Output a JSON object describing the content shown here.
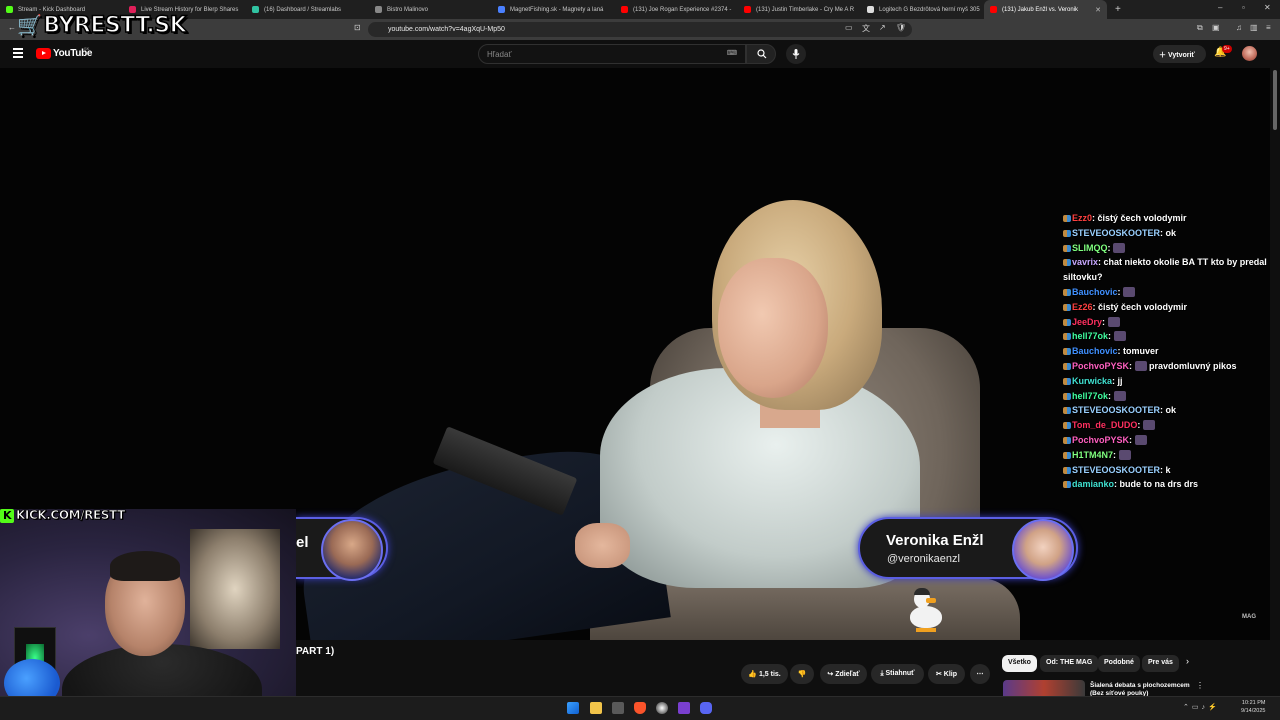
{
  "browser": {
    "tabs": [
      {
        "title": "Stream - Kick Dashboard",
        "color": "#53fc18"
      },
      {
        "title": "Live Stream History for Blerp Shares",
        "color": "#e0205a"
      },
      {
        "title": "(16) Dashboard / Streamlabs",
        "color": "#31c3a2"
      },
      {
        "title": "Bistro Malinovo",
        "color": "#888888"
      },
      {
        "title": "MagnetFishing.sk - Magnety a laná",
        "color": "#4a80ff"
      },
      {
        "title": "(131) Joe Rogan Experience #2374 -",
        "color": "#ff0000"
      },
      {
        "title": "(131) Justin Timberlake - Cry Me A R",
        "color": "#ff0000"
      },
      {
        "title": "Logitech G Bezdrôtová herní myš 305",
        "color": "#dddddd"
      },
      {
        "title": "(131) Jakub Enžl vs. Veronik",
        "color": "#ff0000",
        "active": true
      }
    ],
    "new_tab": "+",
    "url": "youtube.com/watch?v=4agXqU-Mp50"
  },
  "overlay": {
    "logo_text": "BYRESTT.SK",
    "kick_url": "KICK.COM/RESTT",
    "kick_k": "K"
  },
  "youtube": {
    "logo_text": "YouTube",
    "country": "SK",
    "search_placeholder": "Hľadať",
    "create_label": "Vytvoriť",
    "notif_badge": "9+",
    "video_title": "PART 1)",
    "actions": {
      "likes": "1,5 tis.",
      "share": "Zdieľať",
      "download": "Stiahnuť",
      "clip": "Klip",
      "more": "⋯"
    },
    "chips": [
      "Všetko",
      "Od: THE MAG",
      "Podobné",
      "Pre vás"
    ],
    "rec_title": "Šialená debata s plochozemcem (Bez síťové pouky)"
  },
  "video": {
    "left_guest_fragment": "el",
    "right_guest_name": "Veronika Enžl",
    "right_guest_handle": "@veronikaenzl",
    "watermark": "MAG"
  },
  "chat": [
    {
      "user": "Ezz0",
      "color": "#ff4040",
      "msg": "čistý čech volodymir",
      "emote": false
    },
    {
      "user": "STEVEOOSKOOTER",
      "color": "#9ad0ff",
      "msg": "ok",
      "emote": false
    },
    {
      "user": "SLIMQQ",
      "color": "#7fff7f",
      "msg": "",
      "emote": true
    },
    {
      "user": "vavrix",
      "color": "#c8a8ff",
      "msg": "chat niekto okolie BA TT kto by predal siltovku?",
      "emote": false
    },
    {
      "user": "Bauchovic",
      "color": "#4090ff",
      "msg": "",
      "emote": true
    },
    {
      "user": "Ez26",
      "color": "#ff4040",
      "msg": "čistý čech volodymir",
      "emote": false
    },
    {
      "user": "JeeDry",
      "color": "#ff3060",
      "msg": "",
      "emote": true
    },
    {
      "user": "hell77ok",
      "color": "#40ffa0",
      "msg": "",
      "emote": true
    },
    {
      "user": "Bauchovic",
      "color": "#4090ff",
      "msg": "tomuver",
      "emote": false
    },
    {
      "user": "PochvoPYSK",
      "color": "#ff60c0",
      "msg": "pravdomluvný pikos",
      "emote": true
    },
    {
      "user": "Kurwicka",
      "color": "#40e0d0",
      "msg": "jj",
      "emote": false
    },
    {
      "user": "hell77ok",
      "color": "#40ffa0",
      "msg": "",
      "emote": true
    },
    {
      "user": "STEVEOOSKOOTER",
      "color": "#9ad0ff",
      "msg": "ok",
      "emote": false
    },
    {
      "user": "Tom_de_DUDO",
      "color": "#ff3060",
      "msg": "",
      "emote": true
    },
    {
      "user": "PochvoPYSK",
      "color": "#ff60c0",
      "msg": "",
      "emote": true
    },
    {
      "user": "H1TM4N7",
      "color": "#7fff7f",
      "msg": "",
      "emote": true
    },
    {
      "user": "STEVEOOSKOOTER",
      "color": "#9ad0ff",
      "msg": "k",
      "emote": false
    },
    {
      "user": "damianko",
      "color": "#40e0d0",
      "msg": "bude to na drs drs",
      "emote": false
    }
  ],
  "taskbar": {
    "time": "10:21 PM",
    "date": "9/14/2025"
  }
}
